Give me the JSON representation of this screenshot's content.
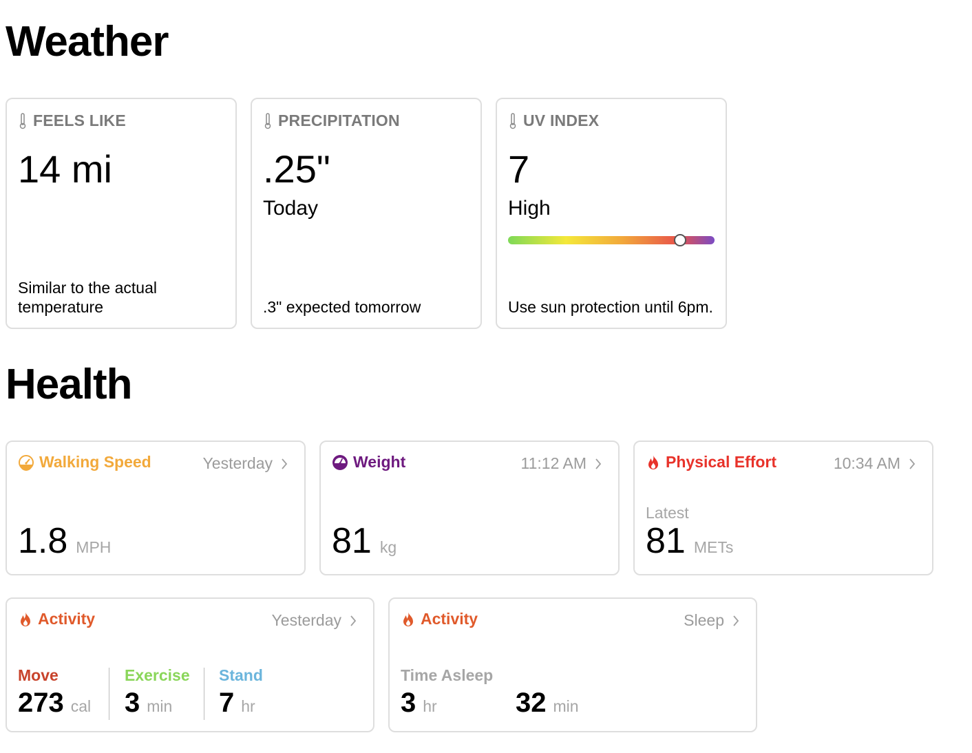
{
  "weather": {
    "title": "Weather",
    "cards": [
      {
        "header": "FEELS LIKE",
        "icon": "thermometer-icon",
        "value": "14 mi",
        "sub": "",
        "footer": "Similar to the actual temperature"
      },
      {
        "header": "PRECIPITATION",
        "icon": "thermometer-icon",
        "value": ".25\"",
        "sub": "Today",
        "footer": ".3\" expected tomorrow"
      },
      {
        "header": "UV INDEX",
        "icon": "thermometer-icon",
        "value": "7",
        "sub": "High",
        "footer": "Use sun protection until 6pm.",
        "uv_level": 0.83
      }
    ]
  },
  "health": {
    "title": "Health",
    "walking": {
      "title": "Walking Speed",
      "icon": "gauge-icon",
      "color": "#f2a93b",
      "time": "Yesterday",
      "value": "1.8",
      "unit": "MPH"
    },
    "weight": {
      "title": "Weight",
      "icon": "scale-icon",
      "color": "#6e1a7f",
      "time": "11:12 AM",
      "value": "81",
      "unit": "kg"
    },
    "effort": {
      "title": "Physical Effort",
      "icon": "flame-icon",
      "color": "#e8322a",
      "time": "10:34 AM",
      "label": "Latest",
      "value": "81",
      "unit": "METs"
    },
    "activity": {
      "title": "Activity",
      "icon": "flame-icon",
      "color": "#e05a2b",
      "time": "Yesterday",
      "move": {
        "label": "Move",
        "value": "273",
        "unit": "cal",
        "color": "#c8432b"
      },
      "exercise": {
        "label": "Exercise",
        "value": "3",
        "unit": "min",
        "color": "#8ad65a"
      },
      "stand": {
        "label": "Stand",
        "value": "7",
        "unit": "hr",
        "color": "#6bb5dc"
      }
    },
    "sleep": {
      "title": "Activity",
      "icon": "flame-icon",
      "color": "#e05a2b",
      "time": "Sleep",
      "label": "Time Asleep",
      "hours": "3",
      "hours_unit": "hr",
      "minutes": "32",
      "minutes_unit": "min"
    }
  }
}
